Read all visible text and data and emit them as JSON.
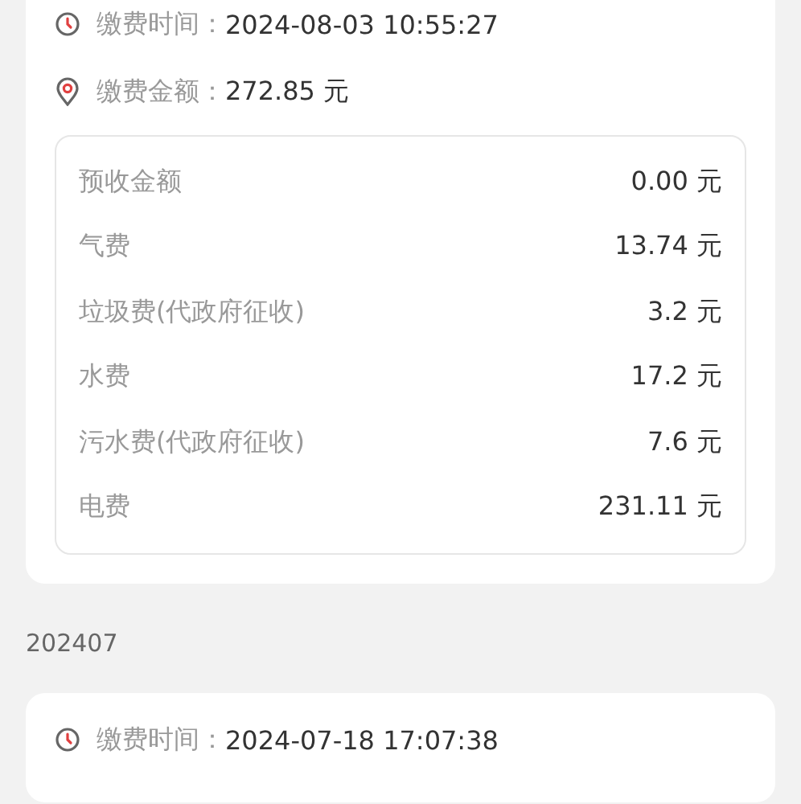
{
  "records": [
    {
      "rows": [
        {
          "kind": "time",
          "label": "缴费时间：",
          "value": "2024-08-03 10:55:27"
        },
        {
          "kind": "amount",
          "label": "缴费金额：",
          "value": "272.85 元"
        }
      ],
      "details": [
        {
          "name": "预收金额",
          "amount": "0.00 元"
        },
        {
          "name": "气费",
          "amount": "13.74 元"
        },
        {
          "name": "垃圾费(代政府征收)",
          "amount": "3.2 元"
        },
        {
          "name": "水费",
          "amount": "17.2 元"
        },
        {
          "name": "污水费(代政府征收)",
          "amount": "7.6 元"
        },
        {
          "name": "电费",
          "amount": "231.11 元"
        }
      ]
    },
    {
      "month": "202407",
      "rows": [
        {
          "kind": "time",
          "label": "缴费时间：",
          "value": "2024-07-18 17:07:38"
        }
      ]
    }
  ]
}
